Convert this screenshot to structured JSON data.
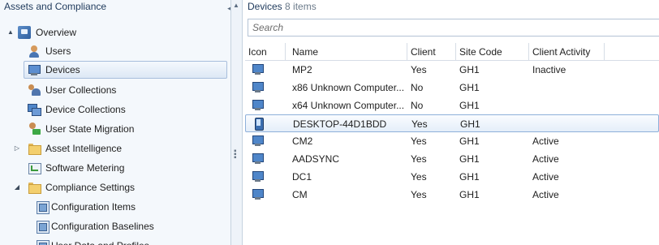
{
  "left_pane": {
    "title": "Assets and Compliance",
    "tree": [
      {
        "label": "Overview",
        "icon": "overview-icon",
        "expander": "▲"
      },
      {
        "label": "Users",
        "icon": "user-icon"
      },
      {
        "label": "Devices",
        "icon": "device-icon",
        "selected": true
      },
      {
        "label": "User Collections",
        "icon": "user-collection-icon"
      },
      {
        "label": "Device Collections",
        "icon": "device-collection-icon"
      },
      {
        "label": "User State Migration",
        "icon": "user-state-migration-icon"
      },
      {
        "label": "Asset Intelligence",
        "icon": "folder-icon",
        "expander": "▷"
      },
      {
        "label": "Software Metering",
        "icon": "software-metering-icon"
      },
      {
        "label": "Compliance Settings",
        "icon": "folder-icon",
        "expander": "◢"
      },
      {
        "label": "Configuration Items",
        "icon": "configuration-item-icon"
      },
      {
        "label": "Configuration Baselines",
        "icon": "configuration-baseline-icon"
      },
      {
        "label": "User Data and Profiles",
        "icon": "user-data-profiles-icon"
      }
    ]
  },
  "content": {
    "title": "Devices",
    "count": "8 items",
    "search_placeholder": "Search",
    "columns": [
      "Icon",
      "Name",
      "Client",
      "Site Code",
      "Client Activity"
    ],
    "rows": [
      {
        "icon": "pc",
        "name": "MP2",
        "client": "Yes",
        "site": "GH1",
        "activity": "Inactive"
      },
      {
        "icon": "pc",
        "name": "x86 Unknown Computer...",
        "client": "No",
        "site": "GH1",
        "activity": ""
      },
      {
        "icon": "pc",
        "name": "x64 Unknown Computer...",
        "client": "No",
        "site": "GH1",
        "activity": ""
      },
      {
        "icon": "mobile",
        "name": "DESKTOP-44D1BDD",
        "client": "Yes",
        "site": "GH1",
        "activity": "",
        "selected": true
      },
      {
        "icon": "pc",
        "name": "CM2",
        "client": "Yes",
        "site": "GH1",
        "activity": "Active"
      },
      {
        "icon": "pc",
        "name": "AADSYNC",
        "client": "Yes",
        "site": "GH1",
        "activity": "Active"
      },
      {
        "icon": "pc",
        "name": "DC1",
        "client": "Yes",
        "site": "GH1",
        "activity": "Active"
      },
      {
        "icon": "pc",
        "name": "CM",
        "client": "Yes",
        "site": "GH1",
        "activity": "Active"
      }
    ]
  },
  "colors": {
    "selection": "#dde8f5",
    "header_text": "#1e395b",
    "pane_bg": "#f4f8fc"
  }
}
